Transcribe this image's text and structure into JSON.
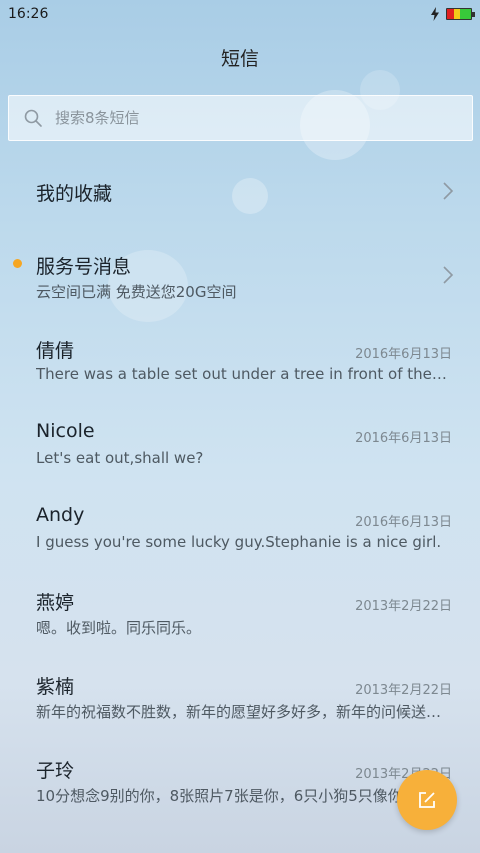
{
  "status": {
    "time": "16:26"
  },
  "header": {
    "title": "短信"
  },
  "search": {
    "placeholder": "搜索8条短信"
  },
  "favorites": {
    "label": "我的收藏"
  },
  "service": {
    "title": "服务号消息",
    "preview": "云空间已满 免费送您20G空间"
  },
  "conversations": [
    {
      "name": "倩倩",
      "date": "2016年6月13日",
      "preview": "There was a table set out under a tree in front of the house"
    },
    {
      "name": "Nicole",
      "date": "2016年6月13日",
      "preview": "Let's eat out,shall we?"
    },
    {
      "name": "Andy",
      "date": "2016年6月13日",
      "preview": "I guess you're some lucky guy.Stephanie is a nice girl."
    },
    {
      "name": "燕婷",
      "date": "2013年2月22日",
      "preview": "嗯。收到啦。同乐同乐。"
    },
    {
      "name": "紫楠",
      "date": "2013年2月22日",
      "preview": "新年的祝福数不胜数，新年的愿望好多好多，新年的问候送给你"
    },
    {
      "name": "子玲",
      "date": "2013年2月22日",
      "preview": "10分想念9别的你，8张照片7张是你，6只小狗5只像你"
    }
  ]
}
